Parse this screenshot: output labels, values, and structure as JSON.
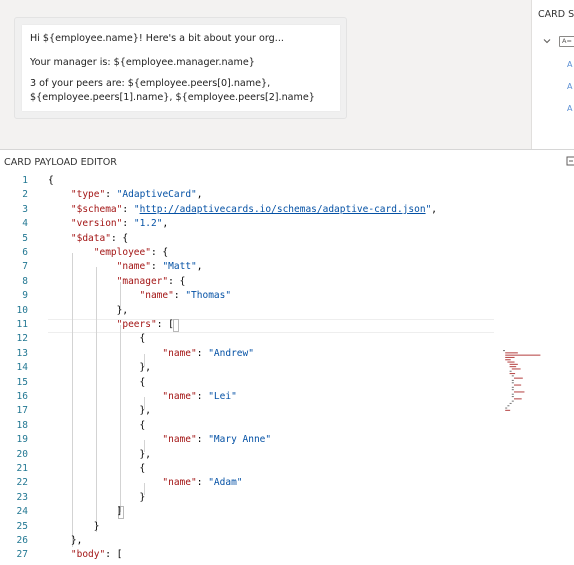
{
  "preview": {
    "card_lines": [
      "Hi ${employee.name}! Here's a bit about your org...",
      "Your manager is: ${employee.manager.name}",
      "3 of your peers are: ${employee.peers[0].name},",
      "${employee.peers[1].name}, ${employee.peers[2].name}"
    ]
  },
  "side_panel": {
    "title": "CARD STRUCTURE",
    "node_icon": "A=",
    "child_icons": [
      "A",
      "A",
      "A"
    ]
  },
  "editor": {
    "title": "CARD PAYLOAD EDITOR",
    "current_line": 11,
    "lines": [
      {
        "n": 1,
        "text": "{"
      },
      {
        "n": 2,
        "text": "    \"type\": \"AdaptiveCard\","
      },
      {
        "n": 3,
        "text": "    \"$schema\": \"http://adaptivecards.io/schemas/adaptive-card.json\","
      },
      {
        "n": 4,
        "text": "    \"version\": \"1.2\","
      },
      {
        "n": 5,
        "text": "    \"$data\": {"
      },
      {
        "n": 6,
        "text": "        \"employee\": {"
      },
      {
        "n": 7,
        "text": "            \"name\": \"Matt\","
      },
      {
        "n": 8,
        "text": "            \"manager\": {"
      },
      {
        "n": 9,
        "text": "                \"name\": \"Thomas\""
      },
      {
        "n": 10,
        "text": "            },"
      },
      {
        "n": 11,
        "text": "            \"peers\": ["
      },
      {
        "n": 12,
        "text": "                {"
      },
      {
        "n": 13,
        "text": "                    \"name\": \"Andrew\""
      },
      {
        "n": 14,
        "text": "                },"
      },
      {
        "n": 15,
        "text": "                {"
      },
      {
        "n": 16,
        "text": "                    \"name\": \"Lei\""
      },
      {
        "n": 17,
        "text": "                },"
      },
      {
        "n": 18,
        "text": "                {"
      },
      {
        "n": 19,
        "text": "                    \"name\": \"Mary Anne\""
      },
      {
        "n": 20,
        "text": "                },"
      },
      {
        "n": 21,
        "text": "                {"
      },
      {
        "n": 22,
        "text": "                    \"name\": \"Adam\""
      },
      {
        "n": 23,
        "text": "                }"
      },
      {
        "n": 24,
        "text": "            ]"
      },
      {
        "n": 25,
        "text": "        }"
      },
      {
        "n": 26,
        "text": "    },"
      },
      {
        "n": 27,
        "text": "    \"body\": ["
      }
    ]
  },
  "colors": {
    "key": "#a31515",
    "string": "#0451a5",
    "line_number": "#237893",
    "preview_background": "#f3f2f1"
  }
}
